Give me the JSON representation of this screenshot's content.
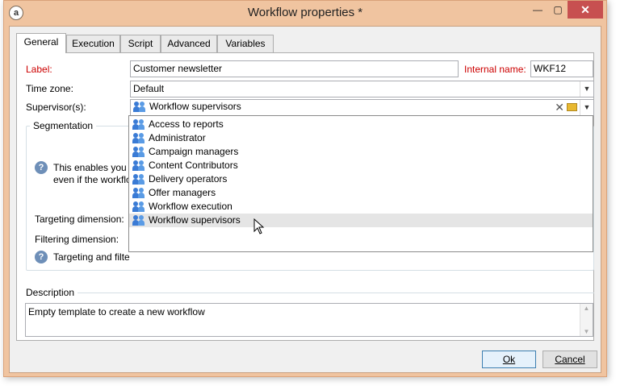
{
  "window": {
    "title": "Workflow properties *",
    "app_icon": "a",
    "minimize_glyph": "—",
    "maximize_glyph": "▢",
    "close_glyph": "✕"
  },
  "tabs": [
    {
      "label": "General",
      "active": true
    },
    {
      "label": "Execution",
      "active": false
    },
    {
      "label": "Script",
      "active": false
    },
    {
      "label": "Advanced",
      "active": false
    },
    {
      "label": "Variables",
      "active": false
    }
  ],
  "general": {
    "label_label": "Label:",
    "label_value": "Customer newsletter",
    "internal_name_label": "Internal name:",
    "internal_name_value": "WKF12",
    "timezone_label": "Time zone:",
    "timezone_value": "Default",
    "supervisors_label": "Supervisor(s):",
    "supervisors_value": "Workflow supervisors",
    "clear_glyph": "✕"
  },
  "segmentation": {
    "legend": "Segmentation",
    "info_text_line1": "This enables you t",
    "info_text_line2": "even if the workflo",
    "targeting_label": "Targeting dimension:",
    "filtering_label": "Filtering dimension:",
    "info2_text": "Targeting and filte",
    "info_glyph": "?"
  },
  "dropdown": {
    "items": [
      "Access to reports",
      "Administrator",
      "Campaign managers",
      "Content Contributors",
      "Delivery operators",
      "Offer managers",
      "Workflow execution",
      "Workflow supervisors"
    ],
    "hovered_index": 7
  },
  "description": {
    "legend": "Description",
    "value": "Empty template to create a new workflow"
  },
  "buttons": {
    "ok": "Ok",
    "cancel": "Cancel"
  },
  "colors": {
    "title_bg": "#f0c4a0",
    "close_button": "#c75050",
    "required_label": "#cc0000",
    "group_icon": "#3a7bd5"
  }
}
